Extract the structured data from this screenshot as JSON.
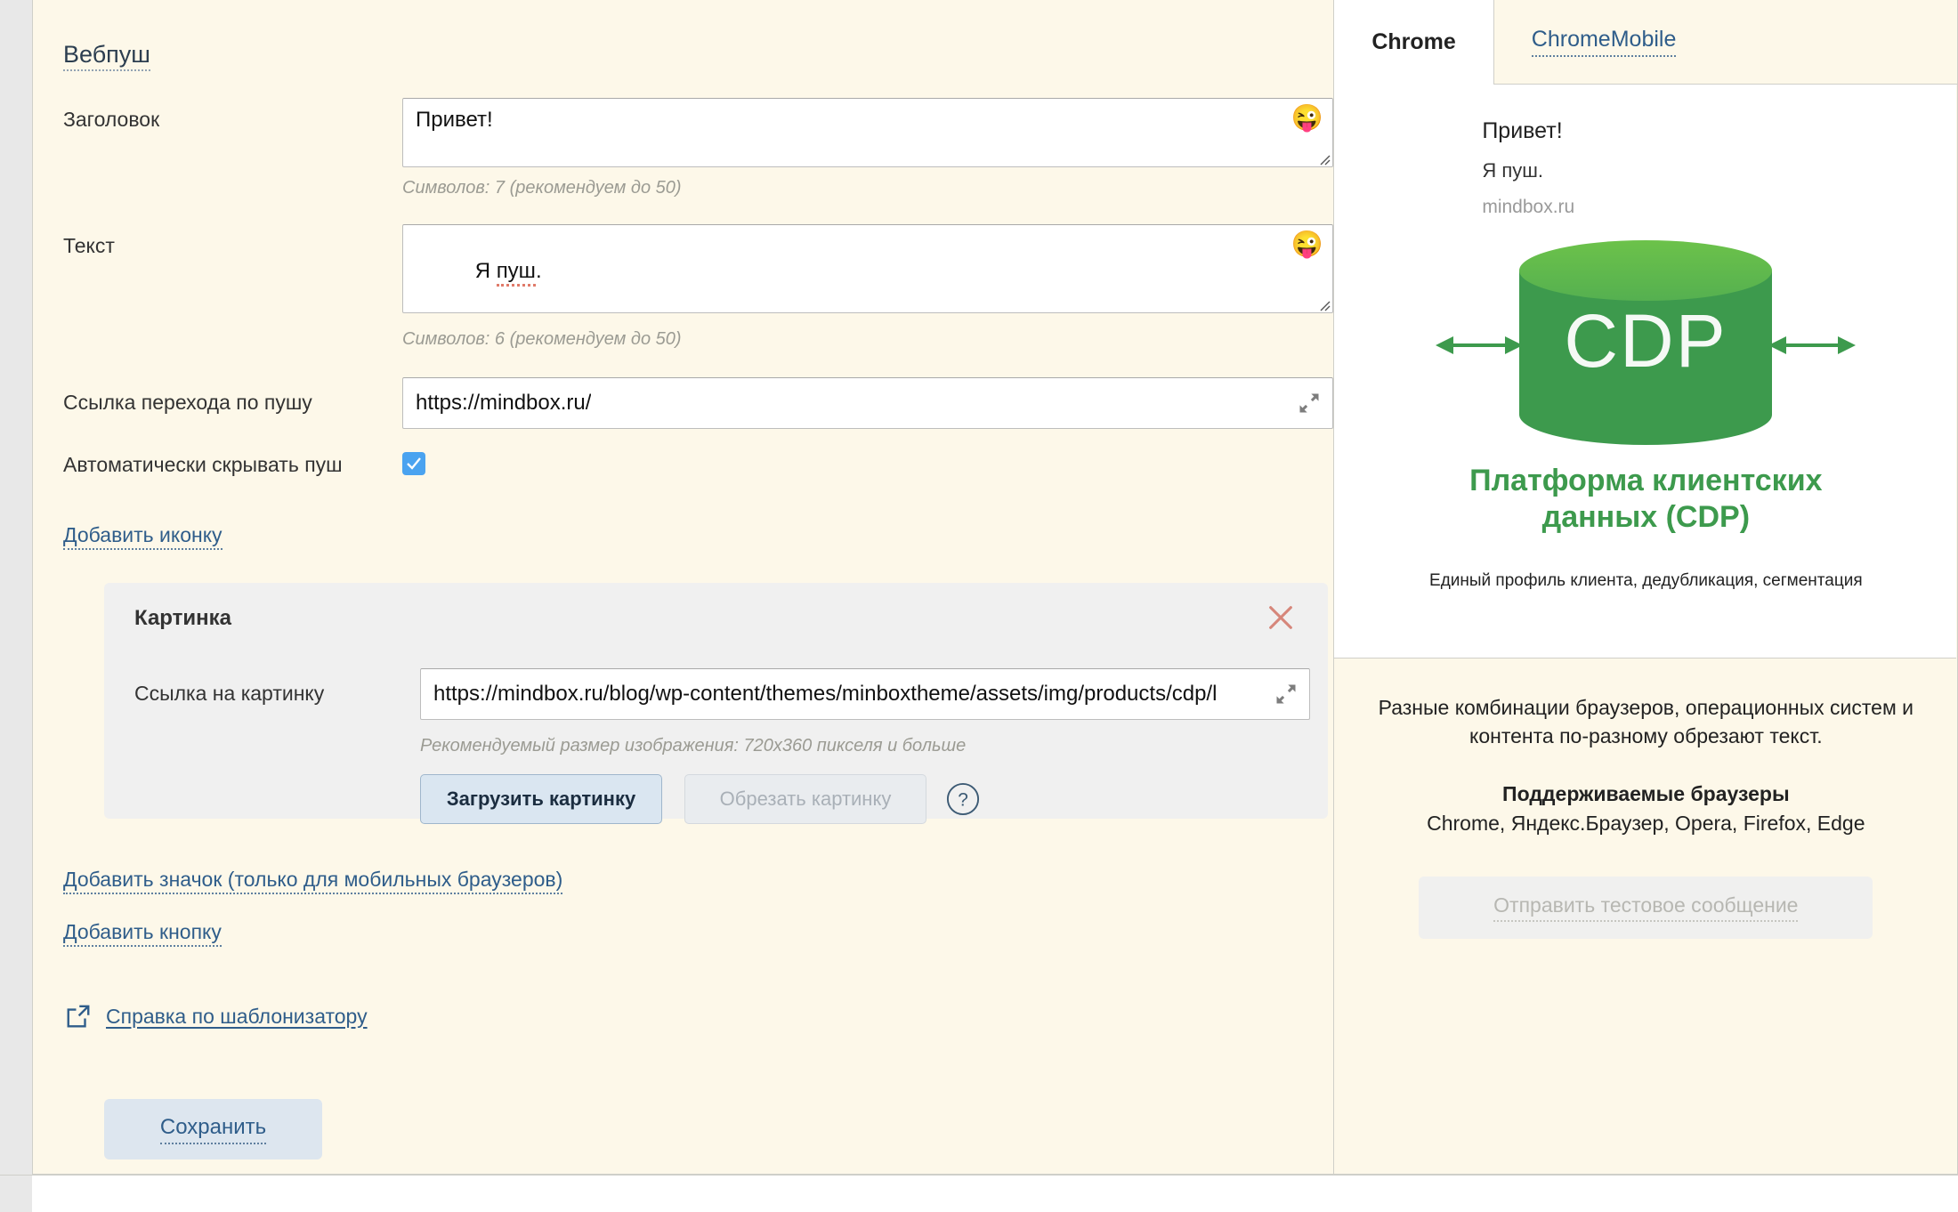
{
  "form": {
    "section_title": "Вебпуш",
    "fields": {
      "header": {
        "label": "Заголовок",
        "value": "Привет!",
        "emoji": "emoji-picker-icon",
        "counter": "Символов: 7 (рекомендуем до 50)"
      },
      "text": {
        "label": "Текст",
        "value_plain": "Я ",
        "value_misspelled": "пуш",
        "value_tail": ".",
        "emoji": "emoji-picker-icon",
        "counter": "Символов: 6 (рекомендуем до 50)"
      },
      "link": {
        "label": "Ссылка перехода по пушу",
        "value": "https://mindbox.ru/"
      },
      "autohide": {
        "label": "Автоматически скрывать пуш",
        "checked": true
      }
    },
    "links": {
      "add_icon": "Добавить иконку",
      "add_badge": "Добавить значок (только для мобильных браузеров)",
      "add_button": "Добавить кнопку",
      "templater_help": "Справка по шаблонизатору"
    },
    "image_card": {
      "title": "Картинка",
      "close": "close-icon",
      "url_label": "Ссылка на картинку",
      "url_value": "https://mindbox.ru/blog/wp-content/themes/minboxtheme/assets/img/products/cdp/l",
      "size_hint": "Рекомендуемый размер изображения: 720x360 пикселя и больше",
      "upload_button": "Загрузить картинку",
      "crop_button": "Обрезать картинку",
      "crop_disabled": true,
      "help_icon": "question-mark-icon"
    },
    "save_button": "Сохранить"
  },
  "preview": {
    "tabs": [
      {
        "label": "Chrome",
        "active": true
      },
      {
        "label": "ChromeMobile",
        "active": false
      }
    ],
    "notification": {
      "title": "Привет!",
      "body": "Я пуш.",
      "domain": "mindbox.ru"
    },
    "image": {
      "cylinder_label": "CDP",
      "caption": "Платформа клиентских данных (CDP)",
      "subcaption": "Единый профиль клиента, дедубликация, сегментация",
      "green_dark": "#3d9a4d",
      "green_light": "#5cb85c"
    },
    "footer": {
      "note": "Разные комбинации браузеров, операционных систем и контента по-разному обрезают текст.",
      "supported_title": "Поддерживаемые браузеры",
      "supported_list": "Chrome, Яндекс.Браузер, Opera, Firefox, Edge",
      "test_button": "Отправить тестовое сообщение"
    }
  }
}
